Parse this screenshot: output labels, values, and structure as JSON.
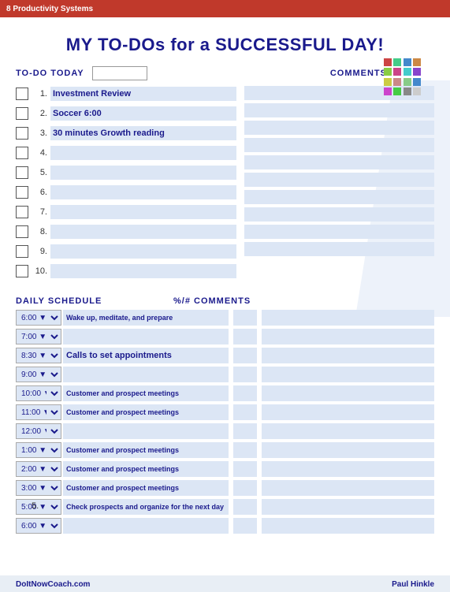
{
  "topBar": {
    "label": "8 Productivity Systems"
  },
  "title": "MY TO-DOs for a SUCCESSFUL DAY!",
  "todoSection": {
    "headerLabel": "TO-DO TODAY",
    "commentsLabel": "COMMENTS",
    "items": [
      {
        "num": "1.",
        "text": "Investment Review"
      },
      {
        "num": "2.",
        "text": "Soccer 6:00"
      },
      {
        "num": "3.",
        "text": "30 minutes Growth reading"
      },
      {
        "num": "4.",
        "text": ""
      },
      {
        "num": "5.",
        "text": ""
      },
      {
        "num": "6.",
        "text": ""
      },
      {
        "num": "7.",
        "text": ""
      },
      {
        "num": "8.",
        "text": ""
      },
      {
        "num": "9.",
        "text": ""
      },
      {
        "num": "10.",
        "text": ""
      }
    ]
  },
  "scheduleSection": {
    "headerLabel": "DAILY SCHEDULE",
    "commentsLabel": "%/#  COMMENTS",
    "rows": [
      {
        "time": "6:00",
        "text": "Wake up, meditate, and prepare",
        "comment": ""
      },
      {
        "time": "7:00",
        "text": "",
        "comment": ""
      },
      {
        "time": "8:30",
        "text": "Calls to set appointments",
        "comment": ""
      },
      {
        "time": "9:00",
        "text": "",
        "comment": ""
      },
      {
        "time": "10:00",
        "text": "Customer and prospect meetings",
        "comment": ""
      },
      {
        "time": "11:00",
        "text": "Customer and prospect meetings",
        "comment": ""
      },
      {
        "time": "12:00",
        "text": "",
        "comment": ""
      },
      {
        "time": "1:00",
        "text": "Customer and prospect meetings",
        "comment": ""
      },
      {
        "time": "2:00",
        "text": "Customer and prospect meetings",
        "comment": ""
      },
      {
        "time": "3:00",
        "text": "Customer and prospect meetings",
        "comment": ""
      },
      {
        "time": "5:00",
        "text": "Check prospects and organize for the next day",
        "comment": ""
      },
      {
        "time": "6:00",
        "text": "",
        "comment": ""
      }
    ]
  },
  "footer": {
    "left": "DoItNowCoach.com",
    "right": "Paul Hinkle"
  },
  "pageNum": "5."
}
